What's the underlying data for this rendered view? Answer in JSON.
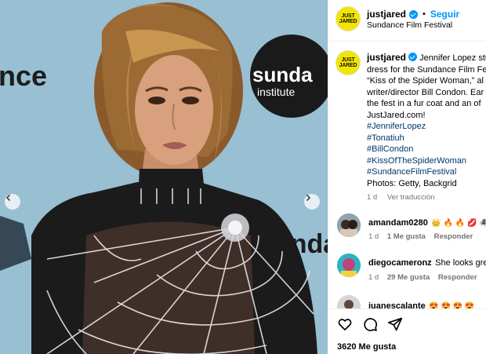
{
  "post": {
    "username": "justjared",
    "follow_label": "Seguir",
    "location": "Sundance Film Festival",
    "avatar_logo_line1": "JUST",
    "avatar_logo_line2": "JARED"
  },
  "media": {
    "backdrop_text_left": "nce",
    "backdrop_logo_main": "sunda",
    "backdrop_logo_sub": "institute",
    "backdrop_text_right": "unda"
  },
  "caption": {
    "username": "justjared",
    "lines": [
      "Jennifer Lopez stun",
      "dress for the Sundance Film Fe",
      "“Kiss of the Spider Woman,” al",
      "writer/director Bill Condon. Ear",
      "the fest in a fur coat and an of",
      "JustJared.com!"
    ],
    "hashtags": [
      "#JenniferLopez",
      "#Tonatiuh",
      "#BillCondon",
      "#KissOfTheSpiderWoman",
      "#SundanceFilmFestival"
    ],
    "photo_credit": "Photos: Getty, Backgrid",
    "time": "1 d",
    "translate_label": "Ver traducción"
  },
  "comments": [
    {
      "username": "amandam0280",
      "text": "👑 🔥 🔥 💋 🕷️ 🕸️",
      "time": "1 d",
      "likes": "1 Me gusta",
      "reply": "Responder"
    },
    {
      "username": "diegocameronz",
      "text": "She looks grea",
      "time": "1 d",
      "likes": "29 Me gusta",
      "reply": "Responder"
    },
    {
      "username": "juanescalante",
      "text": "😍 😍 😍 😍",
      "time": "",
      "likes": "",
      "reply": ""
    }
  ],
  "footer": {
    "likes": "3620 Me gusta"
  },
  "colors": {
    "accent": "#0095f6",
    "backdrop": "#9fc3d6",
    "hashtag": "#00376b",
    "meta": "#737373"
  },
  "icons": [
    "verified-badge-icon",
    "heart-icon",
    "comment-icon",
    "share-icon",
    "chevron-left-icon",
    "chevron-right-icon"
  ]
}
